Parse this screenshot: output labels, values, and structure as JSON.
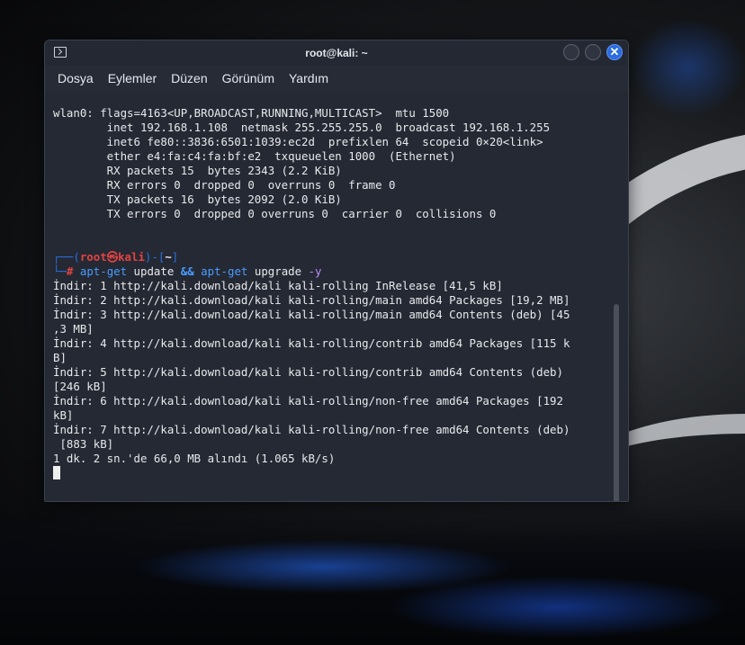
{
  "window": {
    "title": "root@kali: ~",
    "close_glyph": "✕"
  },
  "menu": [
    "Dosya",
    "Eylemler",
    "Düzen",
    "Görünüm",
    "Yardım"
  ],
  "terminal": {
    "ifconfig_lines": [
      "wlan0: flags=4163<UP,BROADCAST,RUNNING,MULTICAST>  mtu 1500",
      "        inet 192.168.1.108  netmask 255.255.255.0  broadcast 192.168.1.255",
      "        inet6 fe80::3836:6501:1039:ec2d  prefixlen 64  scopeid 0×20<link>",
      "        ether e4:fa:c4:fa:bf:e2  txqueuelen 1000  (Ethernet)",
      "        RX packets 15  bytes 2343 (2.2 KiB)",
      "        RX errors 0  dropped 0  overruns 0  frame 0",
      "        TX packets 16  bytes 2092 (2.0 KiB)",
      "        TX errors 0  dropped 0 overruns 0  carrier 0  collisions 0"
    ],
    "prompt": {
      "frame_top_left": "┌──(",
      "user": "root",
      "at": "㉿",
      "host": "kali",
      "frame_mid": ")-[",
      "path": "~",
      "frame_end": "]",
      "frame_bottom": "└─",
      "hash": "#"
    },
    "command": {
      "cmd1": "apt-get",
      "arg1": "update",
      "amp": "&&",
      "cmd2": "apt-get",
      "arg2": "upgrade",
      "opt": "-y"
    },
    "output_lines": [
      "İndir: 1 http://kali.download/kali kali-rolling InRelease [41,5 kB]",
      "İndir: 2 http://kali.download/kali kali-rolling/main amd64 Packages [19,2 MB]",
      "İndir: 3 http://kali.download/kali kali-rolling/main amd64 Contents (deb) [45",
      ",3 MB]",
      "İndir: 4 http://kali.download/kali kali-rolling/contrib amd64 Packages [115 k",
      "B]",
      "İndir: 5 http://kali.download/kali kali-rolling/contrib amd64 Contents (deb)",
      "[246 kB]",
      "İndir: 6 http://kali.download/kali kali-rolling/non-free amd64 Packages [192",
      "kB]",
      "İndir: 7 http://kali.download/kali kali-rolling/non-free amd64 Contents (deb)",
      " [883 kB]",
      "1 dk. 2 sn.'de 66,0 MB alındı (1.065 kB/s)"
    ]
  }
}
